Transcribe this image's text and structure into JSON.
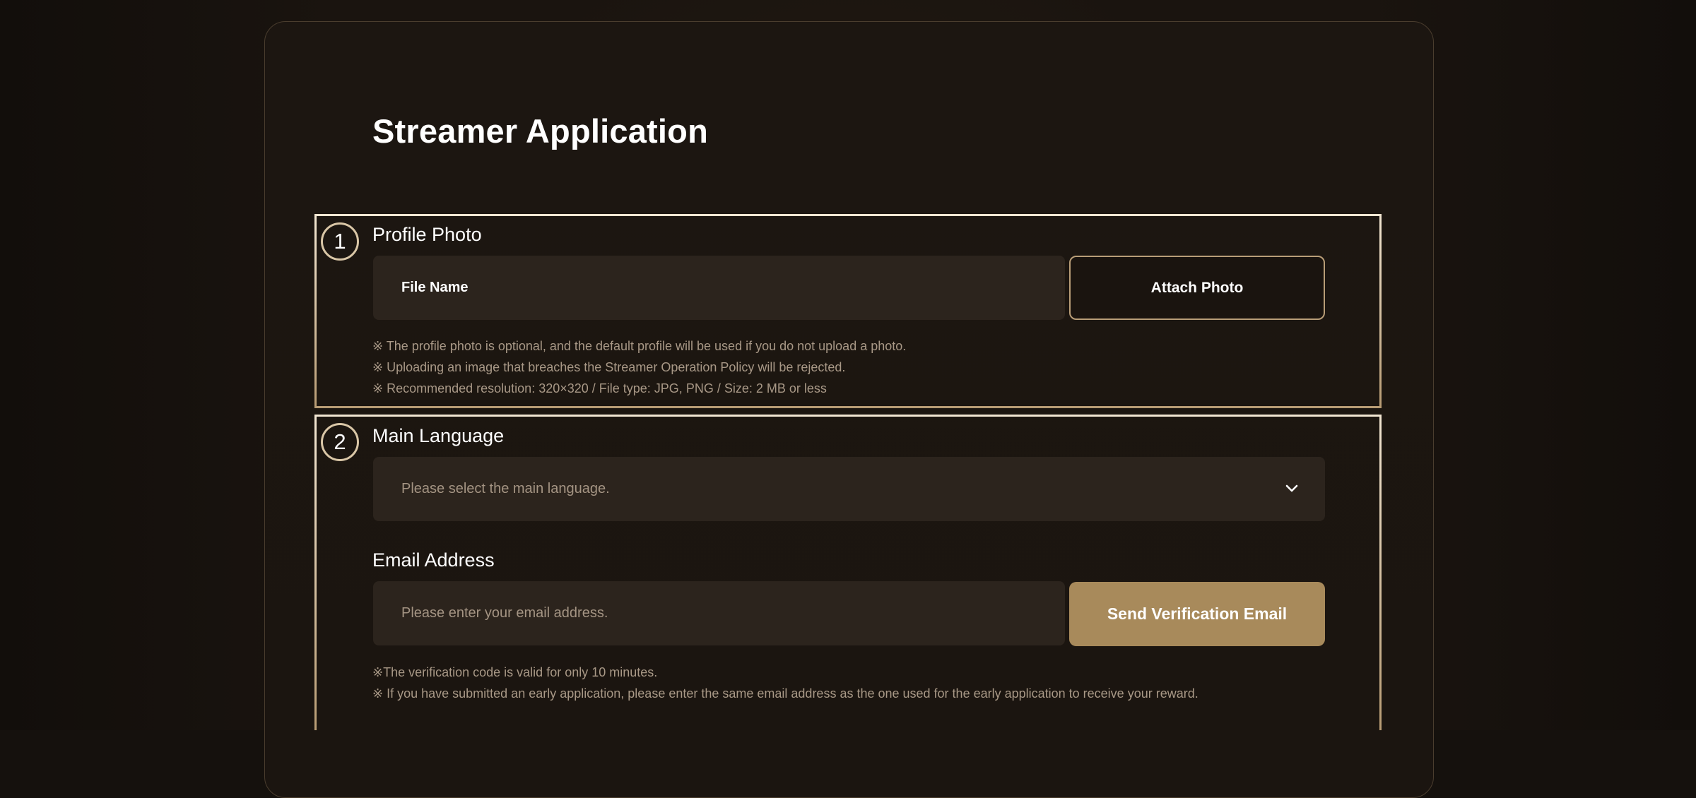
{
  "page": {
    "title": "Streamer Application"
  },
  "profile_photo": {
    "step_number": "1",
    "label": "Profile Photo",
    "file_name_placeholder": "File Name",
    "attach_button": "Attach Photo",
    "notes": [
      "※ The profile photo is optional, and the default profile will be used if you do not upload a photo.",
      "※ Uploading an image that breaches the Streamer Operation Policy will be rejected.",
      "※ Recommended resolution: 320×320 / File type: JPG, PNG / Size: 2 MB or less"
    ]
  },
  "main_language": {
    "step_number": "2",
    "label": "Main Language",
    "select_placeholder": "Please select the main language.",
    "icon": "chevron-down-icon"
  },
  "email": {
    "label": "Email Address",
    "input_placeholder": "Please enter your email address.",
    "send_button": "Send Verification Email",
    "notes": [
      "※The verification code is valid for only 10 minutes.",
      "※ If you have submitted an early application, please enter the same email address as the one used for the early application to receive your reward."
    ]
  },
  "colors": {
    "accent": "#a88a5b",
    "border_light": "#efe2cc",
    "field_bg": "#2c241d"
  }
}
